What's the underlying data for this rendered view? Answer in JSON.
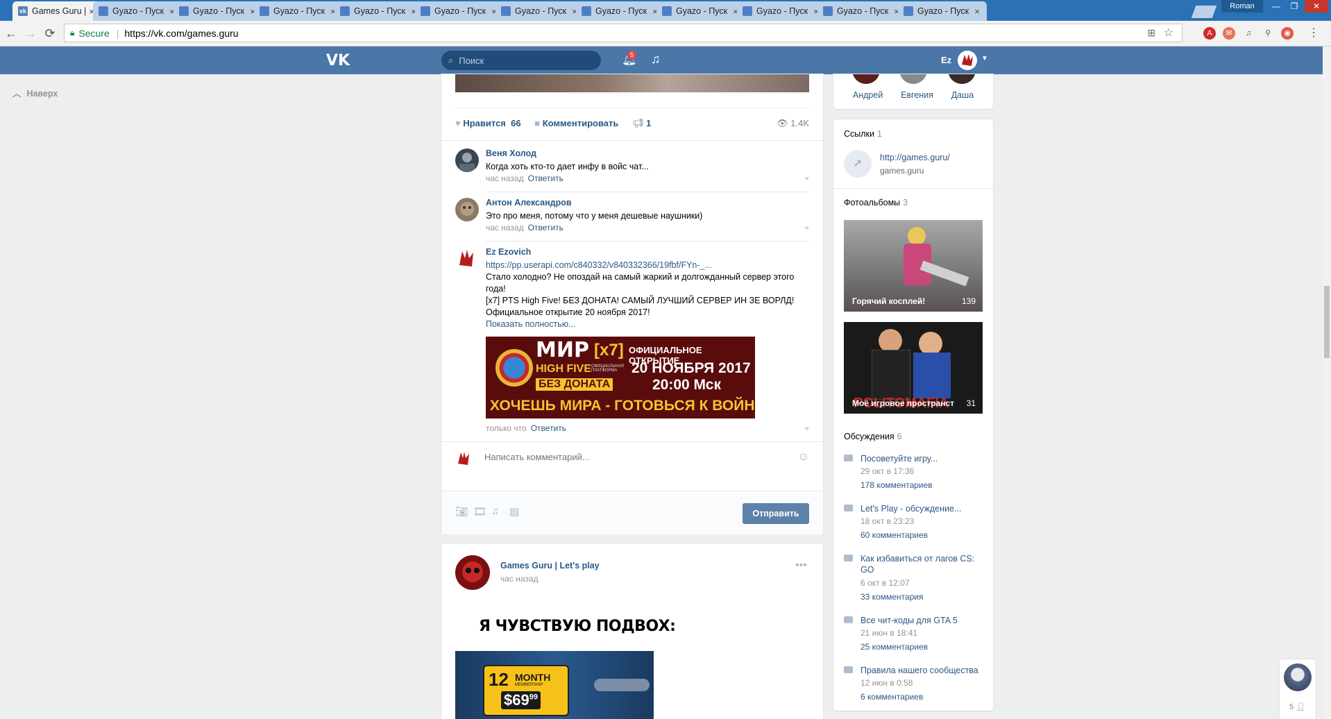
{
  "browser": {
    "tabs": [
      {
        "title": "Games Guru | L",
        "active": true,
        "icon": "vk-favicon"
      },
      {
        "title": "Gyazo - Пуск",
        "active": false,
        "icon": "gyazo-favicon"
      },
      {
        "title": "Gyazo - Пуск",
        "active": false,
        "icon": "gyazo-favicon"
      },
      {
        "title": "Gyazo - Пуск",
        "active": false,
        "icon": "gyazo-favicon"
      },
      {
        "title": "Gyazo - Пуск",
        "active": false,
        "icon": "gyazo-favicon"
      },
      {
        "title": "Gyazo - Пуск",
        "active": false,
        "icon": "gyazo-favicon"
      },
      {
        "title": "Gyazo - Пуск",
        "active": false,
        "icon": "gyazo-favicon"
      },
      {
        "title": "Gyazo - Пуск",
        "active": false,
        "icon": "gyazo-favicon"
      },
      {
        "title": "Gyazo - Пуск",
        "active": false,
        "icon": "gyazo-favicon"
      },
      {
        "title": "Gyazo - Пуск",
        "active": false,
        "icon": "gyazo-favicon"
      },
      {
        "title": "Gyazo - Пуск",
        "active": false,
        "icon": "gyazo-favicon"
      },
      {
        "title": "Gyazo - Пуск",
        "active": false,
        "icon": "gyazo-favicon"
      }
    ],
    "profile_name": "Roman",
    "secure_label": "Secure",
    "url": "https://vk.com/games.guru"
  },
  "vk": {
    "search_placeholder": "Поиск",
    "notifications_count": "5",
    "user_name": "Ez",
    "back_to_top": "Наверх"
  },
  "post1": {
    "likes_label": "Нравится",
    "likes_count": "66",
    "comment_label": "Комментировать",
    "shares_count": "1",
    "views": "1.4K",
    "comments": [
      {
        "author": "Веня Холод",
        "text": "Когда хоть кто-то дает инфу в войс чат...",
        "time": "час назад",
        "reply": "Ответить"
      },
      {
        "author": "Антон Александров",
        "text": "Это про меня, потому что у меня дешевые наушники)",
        "time": "час назад",
        "reply": "Ответить"
      },
      {
        "author": "Ez Ezovich",
        "link": "https://pp.userapi.com/c840332/v840332366/19fbf/FYn-_...",
        "text1": "Стало холодно? Не опоздай на самый жаркий и долгожданный сервер этого года!",
        "text2": "[x7] PTS High Five! БЕЗ ДОНАТА! САМЫЙ ЛУЧШИЙ СЕРВЕР ИН ЗЕ ВОРЛД!",
        "text3": "Официальное открытие 20 ноября 2017!",
        "more": "Показать полностью...",
        "time": "только что",
        "reply": "Ответить"
      }
    ],
    "banner": {
      "l1": "МИР",
      "l1b": "[x7]",
      "l1c": "ОФИЦИАЛЬНОЕ ОТКРЫТИЕ",
      "l2": "HIGH FIVE",
      "l2s": "ОФИЦИАЛЬНАЯ ПЛАТФОРМА",
      "l2c": "20 НОЯБРЯ 2017",
      "l3": "БЕЗ ДОНАТА",
      "l3c": "20:00 Мск",
      "l4": "ХОЧЕШЬ МИРА - ГОТОВЬСЯ К ВОЙНЕ"
    },
    "comment_placeholder": "Написать комментарий...",
    "send_label": "Отправить"
  },
  "post2": {
    "author": "Games Guru | Let's play",
    "time": "час назад",
    "caption": "Я ЧУВСТВУЮ ПОДВОХ:",
    "card_l1": "12",
    "card_l2": "MONTH",
    "card_l3": "MEMBERSHIP",
    "card_price": "$69",
    "card_cents": "99"
  },
  "right": {
    "friends": [
      "Андрей",
      "Евгения",
      "Даша"
    ],
    "links_title": "Ссылки",
    "links_count": "1",
    "link_url": "http://games.guru/",
    "link_domain": "games.guru",
    "albums_title": "Фотоальбомы",
    "albums_count": "3",
    "albums": [
      {
        "name": "Горячий косплей!",
        "count": "139"
      },
      {
        "name": "Моё игровое пространст",
        "count": "31",
        "overlay": "POLITOMAFIA"
      }
    ],
    "disc_title": "Обсуждения",
    "disc_count": "6",
    "discussions": [
      {
        "title": "Посоветуйте игру...",
        "date": "29 окт в 17:36",
        "comments": "178 комментариев"
      },
      {
        "title": "Let's Play - обсуждение...",
        "date": "18 окт в 23:23",
        "comments": "60 комментариев"
      },
      {
        "title": "Как избавиться от лагов CS: GO",
        "date": "6 окт в 12:07",
        "comments": "33 комментария"
      },
      {
        "title": "Все чит-коды для GTA 5",
        "date": "21 июн в 18:41",
        "comments": "25 комментариев"
      },
      {
        "title": "Правила нашего сообщества",
        "date": "12 июн в 0:58",
        "comments": "6 комментариев"
      }
    ]
  },
  "chat_widget": {
    "count": "5"
  }
}
